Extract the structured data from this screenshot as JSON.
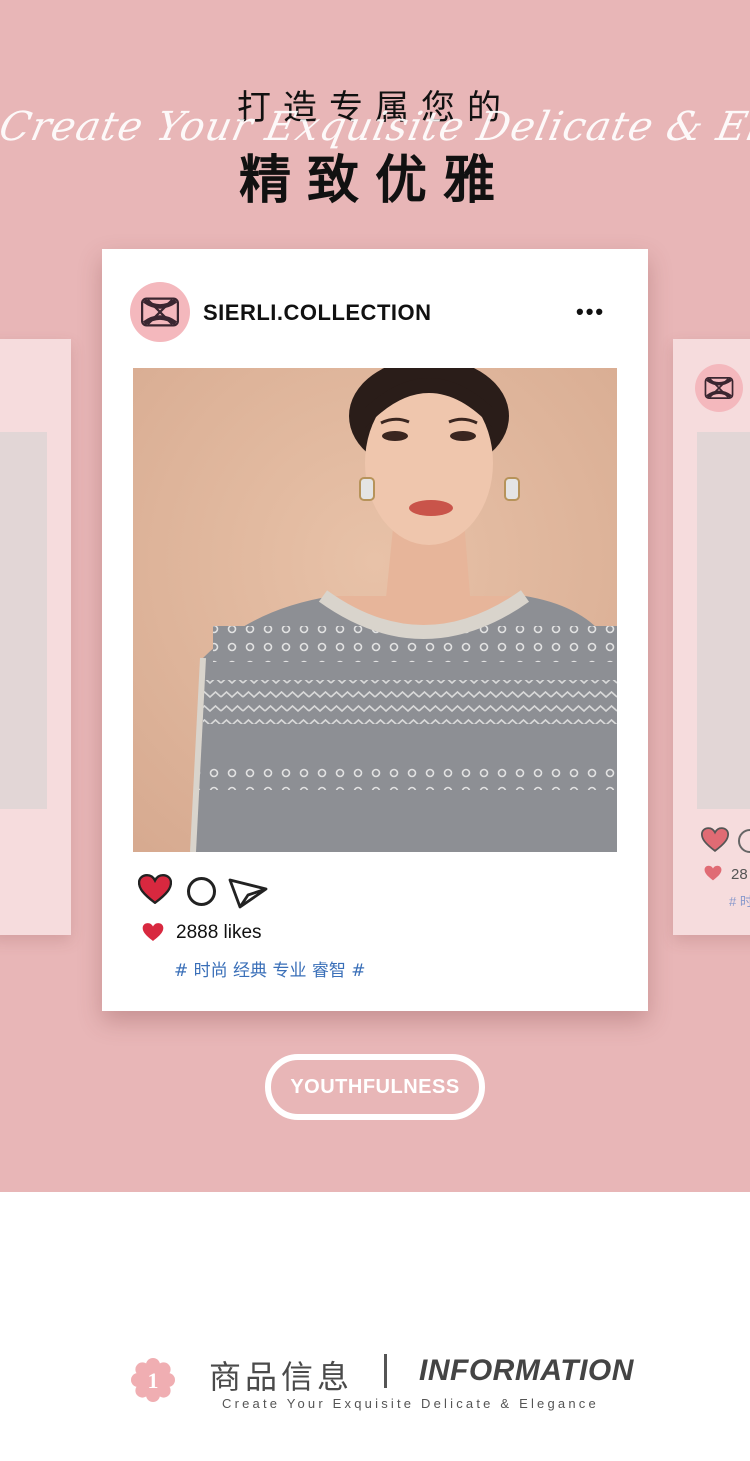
{
  "hero": {
    "title_top": "打造专属您的",
    "script_text": "Create Your Exquisite Delicate & Elegance",
    "title_main": "精致优雅"
  },
  "post": {
    "username": "SIERLI.COLLECTION",
    "more_icon": "•••",
    "likes_text": "2888 likes",
    "tags": "# 时尚 经典 专业 睿智 #",
    "liked": true,
    "accent_color": "#d8283f"
  },
  "side_post": {
    "likes_text": "28",
    "tags": "# 时"
  },
  "badge": {
    "label": "YOUTHFULNESS"
  },
  "info": {
    "number": "1",
    "cn": "商品信息",
    "en": "INFORMATION",
    "sub": "Create Your Exquisite Delicate & Elegance"
  },
  "colors": {
    "hero_bg": "#e8b6b7",
    "card_bg": "#ffffff",
    "avatar_bg": "#f4b8bd",
    "tag_color": "#3a6fb8"
  }
}
